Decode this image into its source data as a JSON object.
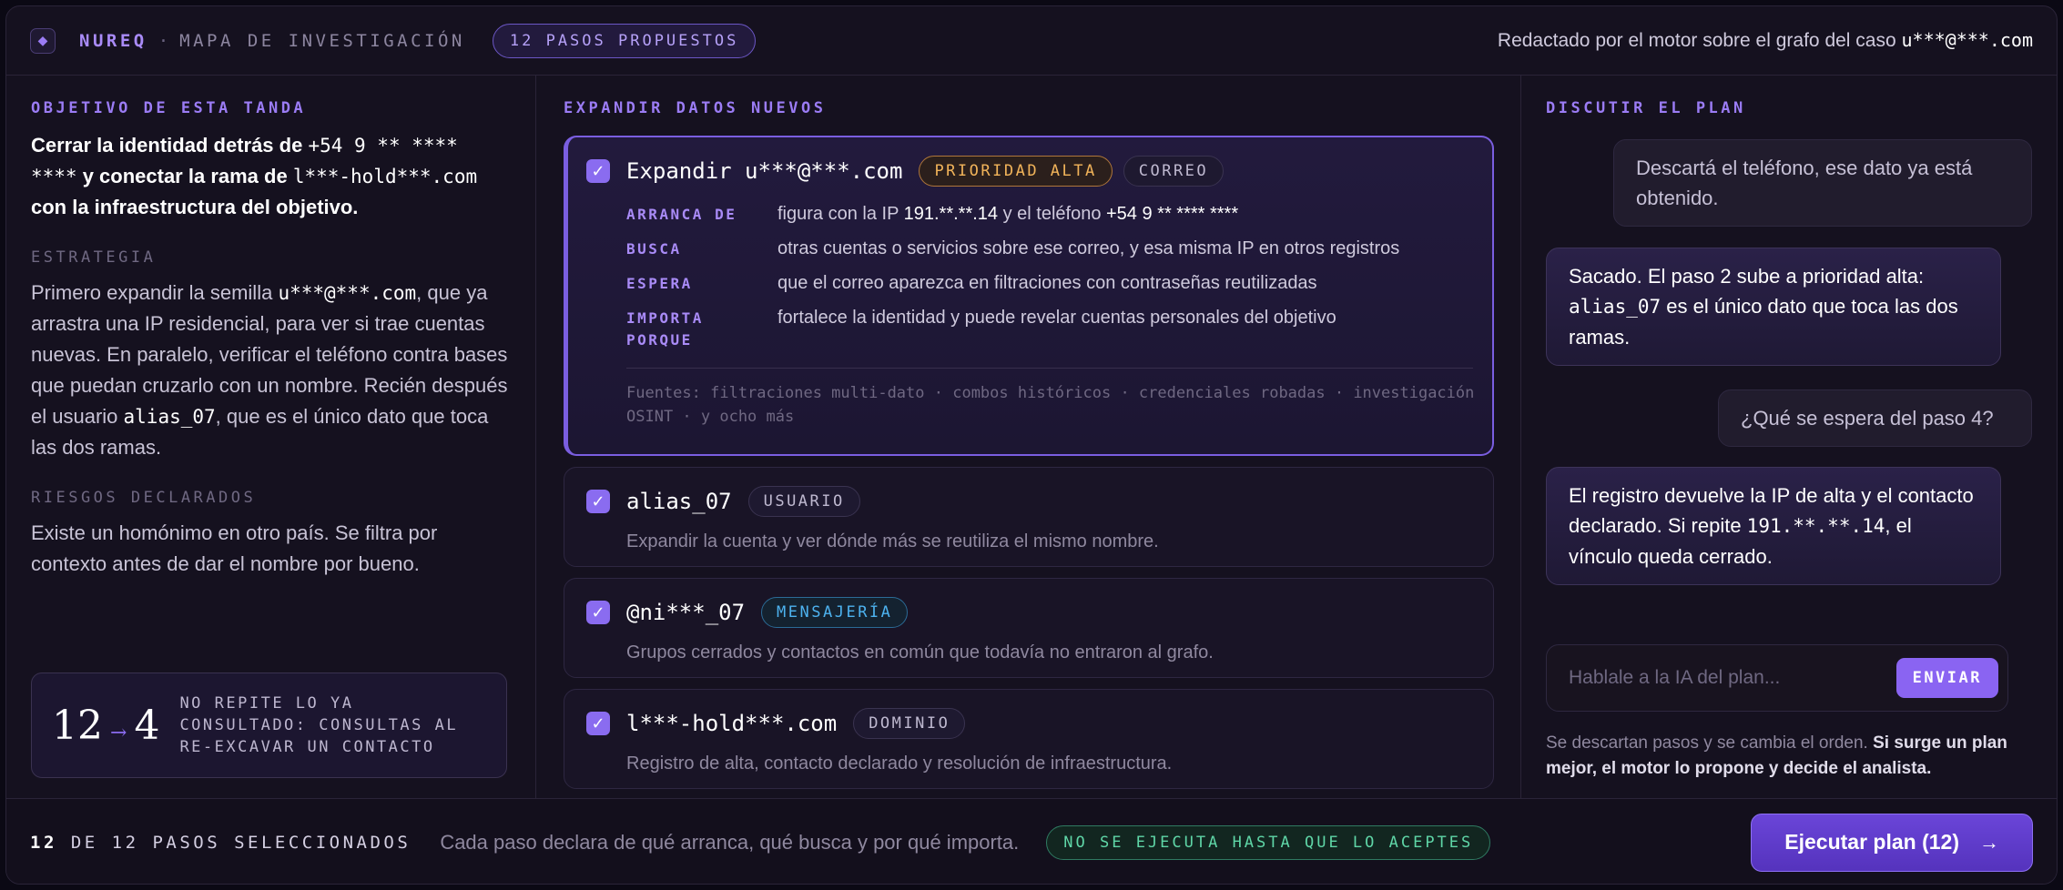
{
  "header": {
    "logo_glyph": "◆",
    "brand": "NUREQ",
    "separator": "·",
    "subtitle": "MAPA DE INVESTIGACIÓN",
    "steps_pill": "12 PASOS PROPUESTOS",
    "drafted_by": "Redactado por el motor sobre el grafo del caso",
    "case_email": "u***@***.com"
  },
  "left": {
    "objective_title": "OBJETIVO DE ESTA TANDA",
    "objective": {
      "p1": "Cerrar la identidad detrás de ",
      "phone": "+54 9 ** **** ****",
      "p2": " y conectar la rama de ",
      "domain": "l***-hold***.com",
      "p3": " con la infraestructura del objetivo."
    },
    "strategy_title": "ESTRATEGIA",
    "strategy": {
      "p1": "Primero expandir la semilla ",
      "seed": "u***@***.com",
      "p2": ", que ya arrastra una IP residencial, para ver si trae cuentas nuevas. En paralelo, verificar el teléfono contra bases que puedan cruzarlo con un nombre. Recién después el usuario ",
      "user": "alias_07",
      "p3": ", que es el único dato que toca las dos ramas."
    },
    "risks_title": "RIESGOS DECLARADOS",
    "risks": "Existe un homónimo en otro país. Se filtra por contexto antes de dar el nombre por bueno.",
    "stat": {
      "from": "12",
      "arrow": "→",
      "to": "4",
      "text": "NO REPITE LO YA CONSULTADO: CONSULTAS AL RE-EXCAVAR UN CONTACTO"
    }
  },
  "middle": {
    "title": "EXPANDIR DATOS NUEVOS",
    "check_glyph": "✓",
    "steps": [
      {
        "title_prefix": "Expandir ",
        "title": "u***@***.com",
        "tags": [
          {
            "label": "PRIORIDAD ALTA",
            "style": "orange"
          },
          {
            "label": "CORREO",
            "style": "neutral"
          }
        ],
        "details": {
          "starts_label": "ARRANCA DE",
          "starts_p1": "figura con la IP ",
          "starts_ip": "191.**.**.14",
          "starts_p2": " y el teléfono ",
          "starts_phone": "+54 9 ** **** ****",
          "seeks_label": "BUSCA",
          "seeks": "otras cuentas o servicios sobre ese correo, y esa misma IP en otros registros",
          "expects_label": "ESPERA",
          "expects": "que el correo aparezca en filtraciones con contraseñas reutilizadas",
          "matters_label": "IMPORTA PORQUE",
          "matters": "fortalece la identidad y puede revelar cuentas personales del objetivo"
        },
        "sources": "Fuentes: filtraciones multi-dato · combos históricos · credenciales robadas · investigación OSINT · y ocho más"
      },
      {
        "title": "alias_07",
        "tag": {
          "label": "USUARIO",
          "style": "neutral"
        },
        "desc": "Expandir la cuenta y ver dónde más se reutiliza el mismo nombre."
      },
      {
        "title": "@ni***_07",
        "tag": {
          "label": "MENSAJERÍA",
          "style": "blue"
        },
        "desc": "Grupos cerrados y contactos en común que todavía no entraron al grafo."
      },
      {
        "title": "l***-hold***.com",
        "tag": {
          "label": "DOMINIO",
          "style": "neutral"
        },
        "desc": "Registro de alta, contacto declarado y resolución de infraestructura."
      }
    ]
  },
  "right": {
    "title": "DISCUTIR EL PLAN",
    "messages": [
      {
        "role": "user",
        "text": "Descartá el teléfono, ese dato ya está obtenido."
      },
      {
        "role": "ai",
        "p1": "Sacado. El paso 2 sube a prioridad alta: ",
        "code": "alias_07",
        "p2": " es el único dato que toca las dos ramas."
      },
      {
        "role": "user",
        "text": "¿Qué se espera del paso 4?"
      },
      {
        "role": "ai",
        "p1": "El registro devuelve la IP de alta y el contacto declarado. Si repite ",
        "code": "191.**.**.14",
        "p2": ", el vínculo queda cerrado."
      }
    ],
    "input_placeholder": "Hablale a la IA del plan...",
    "input_value": "",
    "send_label": "ENVIAR",
    "note_p1": "Se descartan pasos y se cambia el orden. ",
    "note_p2": "Si surge un plan mejor, el motor lo propone y decide el analista."
  },
  "footer": {
    "count_selected": "12",
    "count_rest": " DE 12 PASOS SELECCIONADOS",
    "desc": "Cada paso declara de qué arranca, qué busca y por qué importa.",
    "pill": "NO SE EJECUTA HASTA QUE LO ACEPTES",
    "execute_label": "Ejecutar plan (12)",
    "execute_arrow": "→"
  },
  "colors": {
    "accent": "#8a64f2",
    "priority_high": "#f2b45a",
    "messaging": "#4db2ef",
    "safe": "#5fd6a7"
  }
}
